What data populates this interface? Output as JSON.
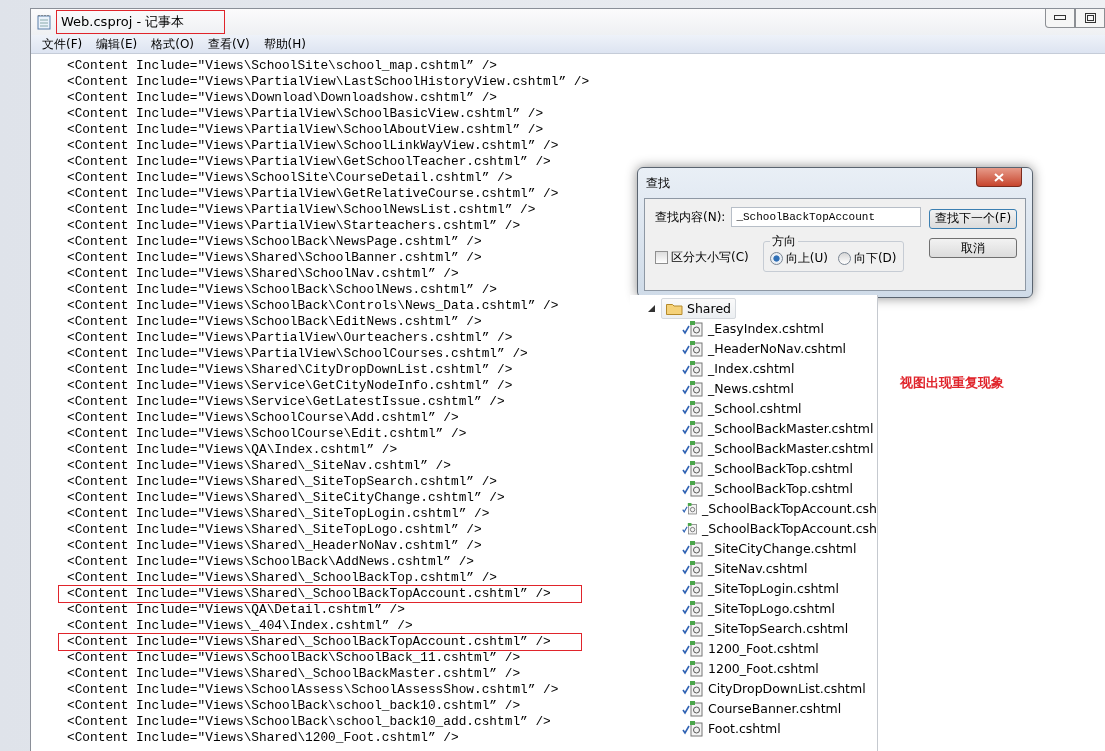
{
  "window": {
    "title": "Web.csproj - 记事本",
    "title_highlighted": true
  },
  "menu": [
    "文件(F)",
    "编辑(E)",
    "格式(O)",
    "查看(V)",
    "帮助(H)"
  ],
  "editor": {
    "lines": [
      {
        "text": "<Content Include=\"Views\\SchoolSite\\school_map.cshtml” />",
        "highlighted": false
      },
      {
        "text": "<Content Include=\"Views\\PartialView\\LastSchoolHistoryView.cshtml” />",
        "highlighted": false
      },
      {
        "text": "<Content Include=\"Views\\Download\\Downloadshow.cshtml” />",
        "highlighted": false
      },
      {
        "text": "<Content Include=\"Views\\PartialView\\SchoolBasicView.cshtml” />",
        "highlighted": false
      },
      {
        "text": "<Content Include=\"Views\\PartialView\\SchoolAboutView.cshtml” />",
        "highlighted": false
      },
      {
        "text": "<Content Include=\"Views\\PartialView\\SchoolLinkWayView.cshtml” />",
        "highlighted": false
      },
      {
        "text": "<Content Include=\"Views\\PartialView\\GetSchoolTeacher.cshtml” />",
        "highlighted": false
      },
      {
        "text": "<Content Include=\"Views\\SchoolSite\\CourseDetail.cshtml” />",
        "highlighted": false
      },
      {
        "text": "<Content Include=\"Views\\PartialView\\GetRelativeCourse.cshtml” />",
        "highlighted": false
      },
      {
        "text": "<Content Include=\"Views\\PartialView\\SchoolNewsList.cshtml” />",
        "highlighted": false
      },
      {
        "text": "<Content Include=\"Views\\PartialView\\Starteachers.cshtml” />",
        "highlighted": false
      },
      {
        "text": "<Content Include=\"Views\\SchoolBack\\NewsPage.cshtml” />",
        "highlighted": false
      },
      {
        "text": "<Content Include=\"Views\\Shared\\SchoolBanner.cshtml” />",
        "highlighted": false
      },
      {
        "text": "<Content Include=\"Views\\Shared\\SchoolNav.cshtml” />",
        "highlighted": false
      },
      {
        "text": "<Content Include=\"Views\\SchoolBack\\SchoolNews.cshtml” />",
        "highlighted": false
      },
      {
        "text": "<Content Include=\"Views\\SchoolBack\\Controls\\News_Data.cshtml” />",
        "highlighted": false
      },
      {
        "text": "<Content Include=\"Views\\SchoolBack\\EditNews.cshtml” />",
        "highlighted": false
      },
      {
        "text": "<Content Include=\"Views\\PartialView\\Ourteachers.cshtml” />",
        "highlighted": false
      },
      {
        "text": "<Content Include=\"Views\\PartialView\\SchoolCourses.cshtml” />",
        "highlighted": false
      },
      {
        "text": "<Content Include=\"Views\\Shared\\CityDropDownList.cshtml” />",
        "highlighted": false
      },
      {
        "text": "<Content Include=\"Views\\Service\\GetCityNodeInfo.cshtml” />",
        "highlighted": false
      },
      {
        "text": "<Content Include=\"Views\\Service\\GetLatestIssue.cshtml” />",
        "highlighted": false
      },
      {
        "text": "<Content Include=\"Views\\SchoolCourse\\Add.cshtml” />",
        "highlighted": false
      },
      {
        "text": "<Content Include=\"Views\\SchoolCourse\\Edit.cshtml” />",
        "highlighted": false
      },
      {
        "text": "<Content Include=\"Views\\QA\\Index.cshtml” />",
        "highlighted": false
      },
      {
        "text": "<Content Include=\"Views\\Shared\\_SiteNav.cshtml” />",
        "highlighted": false
      },
      {
        "text": "<Content Include=\"Views\\Shared\\_SiteTopSearch.cshtml” />",
        "highlighted": false
      },
      {
        "text": "<Content Include=\"Views\\Shared\\_SiteCityChange.cshtml” />",
        "highlighted": false
      },
      {
        "text": "<Content Include=\"Views\\Shared\\_SiteTopLogin.cshtml” />",
        "highlighted": false
      },
      {
        "text": "<Content Include=\"Views\\Shared\\_SiteTopLogo.cshtml” />",
        "highlighted": false
      },
      {
        "text": "<Content Include=\"Views\\Shared\\_HeaderNoNav.cshtml” />",
        "highlighted": false
      },
      {
        "text": "<Content Include=\"Views\\SchoolBack\\AddNews.cshtml” />",
        "highlighted": false
      },
      {
        "text": "<Content Include=\"Views\\Shared\\_SchoolBackTop.cshtml” />",
        "highlighted": false
      },
      {
        "text": "<Content Include=\"Views\\Shared\\_SchoolBackTopAccount.cshtml” />",
        "highlighted": true
      },
      {
        "text": "<Content Include=\"Views\\QA\\Detail.cshtml” />",
        "highlighted": false
      },
      {
        "text": "<Content Include=\"Views\\_404\\Index.cshtml” />",
        "highlighted": false
      },
      {
        "text": "<Content Include=\"Views\\Shared\\_SchoolBackTopAccount.cshtml” />",
        "highlighted": true
      },
      {
        "text": "<Content Include=\"Views\\SchoolBack\\SchoolBack_11.cshtml” />",
        "highlighted": false
      },
      {
        "text": "<Content Include=\"Views\\Shared\\_SchoolBackMaster.cshtml” />",
        "highlighted": false
      },
      {
        "text": "<Content Include=\"Views\\SchoolAssess\\SchoolAssessShow.cshtml” />",
        "highlighted": false
      },
      {
        "text": "<Content Include=\"Views\\SchoolBack\\school_back10.cshtml” />",
        "highlighted": false
      },
      {
        "text": "<Content Include=\"Views\\SchoolBack\\school_back10_add.cshtml” />",
        "highlighted": false
      },
      {
        "text": "<Content Include=\"Views\\Shared\\1200_Foot.cshtml” />",
        "highlighted": false
      }
    ]
  },
  "find_dialog": {
    "title": "查找",
    "find_label": "查找内容(N):",
    "find_value": "_SchoolBackTopAccount",
    "find_next": "查找下一个(F)",
    "cancel": "取消",
    "match_case": {
      "label": "区分大小写(C)",
      "checked": false
    },
    "direction": {
      "label": "方向",
      "options": [
        {
          "label": "向上(U)",
          "selected": true
        },
        {
          "label": "向下(D)",
          "selected": false
        }
      ]
    }
  },
  "solution_tree": {
    "folder": "Shared",
    "expanded": true,
    "children": [
      {
        "label": "_EasyIndex.cshtml"
      },
      {
        "label": "_HeaderNoNav.cshtml"
      },
      {
        "label": "_Index.cshtml"
      },
      {
        "label": "_News.cshtml"
      },
      {
        "label": "_School.cshtml"
      },
      {
        "label": "_SchoolBackMaster.cshtml"
      },
      {
        "label": "_SchoolBackMaster.cshtml"
      },
      {
        "label": "_SchoolBackTop.cshtml"
      },
      {
        "label": "_SchoolBackTop.cshtml"
      },
      {
        "label": "_SchoolBackTopAccount.csh"
      },
      {
        "label": "_SchoolBackTopAccount.csh"
      },
      {
        "label": "_SiteCityChange.cshtml"
      },
      {
        "label": "_SiteNav.cshtml"
      },
      {
        "label": "_SiteTopLogin.cshtml"
      },
      {
        "label": "_SiteTopLogo.cshtml"
      },
      {
        "label": "_SiteTopSearch.cshtml"
      },
      {
        "label": "1200_Foot.cshtml"
      },
      {
        "label": "1200_Foot.cshtml"
      },
      {
        "label": "CityDropDownList.cshtml"
      },
      {
        "label": "CourseBanner.cshtml"
      },
      {
        "label": "Foot.cshtml"
      }
    ]
  },
  "note": "视图出现重复现象"
}
